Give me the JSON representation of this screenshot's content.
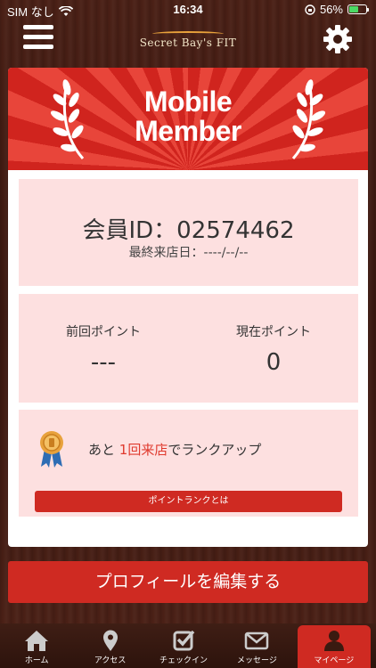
{
  "status_bar": {
    "carrier": "SIM なし",
    "time": "16:34",
    "battery": "56%",
    "battery_level": 0.56
  },
  "header": {
    "logo_text": "Secret Bay's FIT",
    "menu_icon": "hamburger-icon",
    "settings_icon": "gear-icon"
  },
  "banner": {
    "title_line1": "Mobile",
    "title_line2": "Member"
  },
  "member": {
    "id_label": "会員ID：02574462",
    "last_visit": "最終来店日：----/--/--"
  },
  "points": {
    "previous_label": "前回ポイント",
    "previous_value": "---",
    "current_label": "現在ポイント",
    "current_value": "0"
  },
  "rank": {
    "prefix": "あと ",
    "highlight": "1回来店",
    "suffix": "でランクアップ",
    "button_label": "ポイントランクとは"
  },
  "edit_profile_label": "プロフィールを編集する",
  "tabs": [
    {
      "label": "ホーム",
      "icon": "home-icon"
    },
    {
      "label": "アクセス",
      "icon": "map-pin-icon"
    },
    {
      "label": "チェックイン",
      "icon": "checkbox-icon"
    },
    {
      "label": "メッセージ",
      "icon": "envelope-icon"
    },
    {
      "label": "マイページ",
      "icon": "user-icon",
      "active": true
    }
  ],
  "colors": {
    "accent": "#cf2a22",
    "panel": "#fde0e0",
    "highlight_text": "#e03a2e"
  }
}
